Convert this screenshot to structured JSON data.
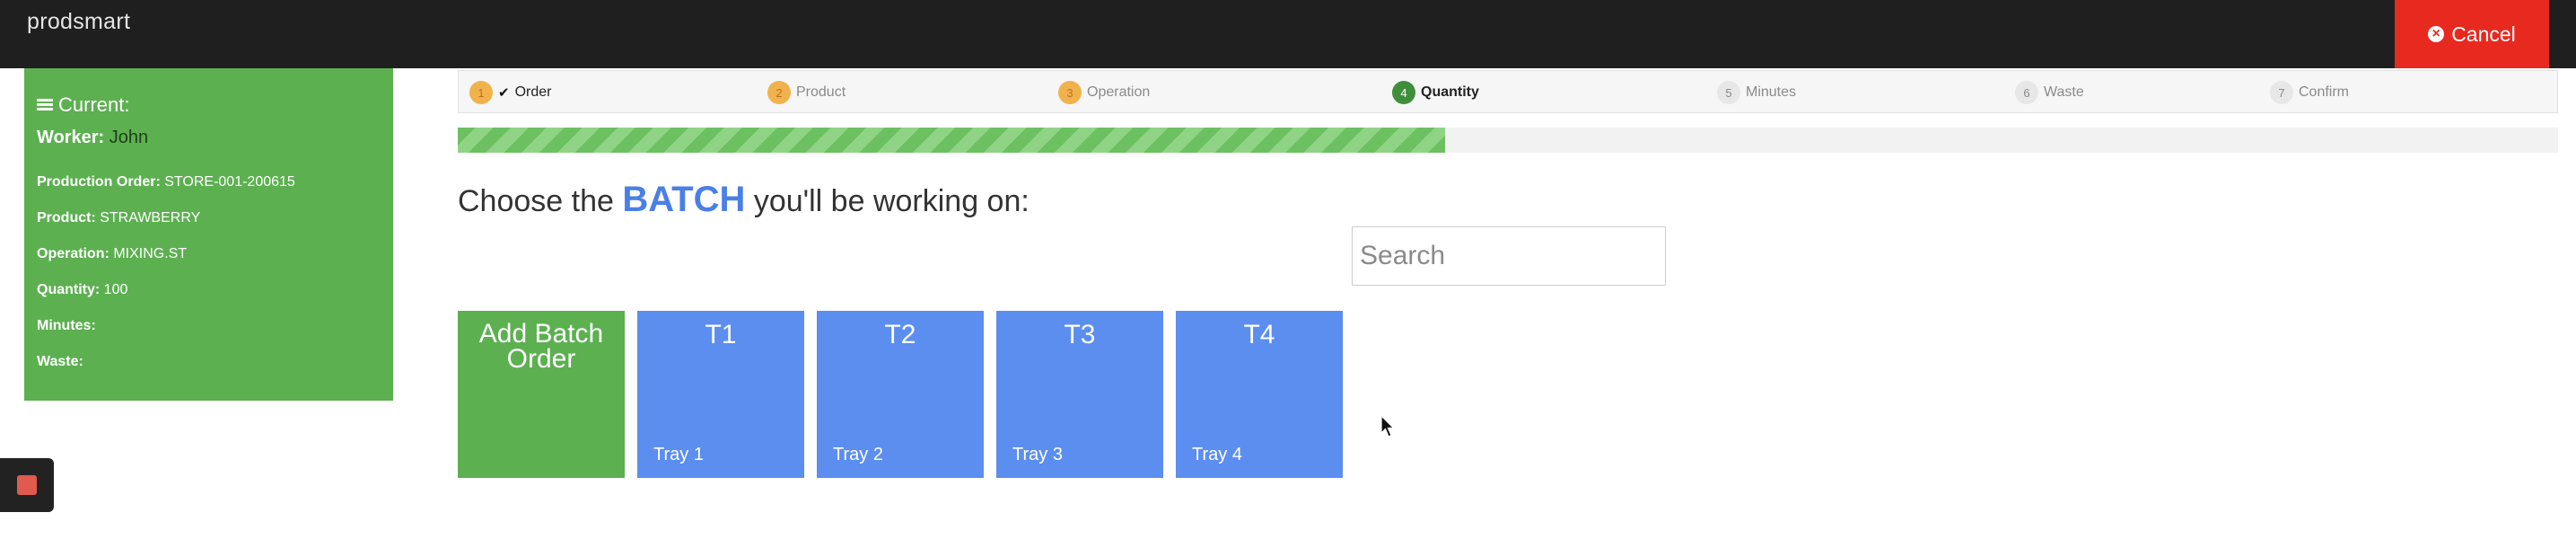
{
  "app": {
    "brand": "prodsmart"
  },
  "header": {
    "cancel_label": "Cancel",
    "cancel_icon": "times-circle-icon"
  },
  "sidebar": {
    "title": "Current:",
    "worker_label": "Worker:",
    "worker_value": "John",
    "fields": [
      {
        "label": "Production Order:",
        "value": "STORE-001-200615"
      },
      {
        "label": "Product:",
        "value": "STRAWBERRY"
      },
      {
        "label": "Operation:",
        "value": "MIXING.ST"
      },
      {
        "label": "Quantity:",
        "value": "100"
      },
      {
        "label": "Minutes:",
        "value": ""
      },
      {
        "label": "Waste:",
        "value": ""
      }
    ]
  },
  "steps": [
    {
      "num": "1",
      "label": "Order",
      "state": "done",
      "check": "✔"
    },
    {
      "num": "2",
      "label": "Product",
      "state": "pending-orange"
    },
    {
      "num": "3",
      "label": "Operation",
      "state": "pending-orange"
    },
    {
      "num": "4",
      "label": "Quantity",
      "state": "current"
    },
    {
      "num": "5",
      "label": "Minutes",
      "state": "todo"
    },
    {
      "num": "6",
      "label": "Waste",
      "state": "todo"
    },
    {
      "num": "7",
      "label": "Confirm",
      "state": "todo"
    }
  ],
  "progress": {
    "percent": 47
  },
  "main": {
    "heading_pre": "Choose the ",
    "heading_emphasis": "BATCH",
    "heading_post": " you'll be working on:",
    "search_placeholder": "Search",
    "add_batch_label": "Add Batch Order",
    "batches": [
      {
        "code": "T1",
        "name": "Tray 1"
      },
      {
        "code": "T2",
        "name": "Tray 2"
      },
      {
        "code": "T3",
        "name": "Tray 3"
      },
      {
        "code": "T4",
        "name": "Tray 4"
      }
    ]
  },
  "colors": {
    "topbar": "#1f1f1f",
    "cancel": "#e8291f",
    "sidebar": "#5cb050",
    "batch_tile": "#5b8eef",
    "accent": "#4a7fe6"
  }
}
